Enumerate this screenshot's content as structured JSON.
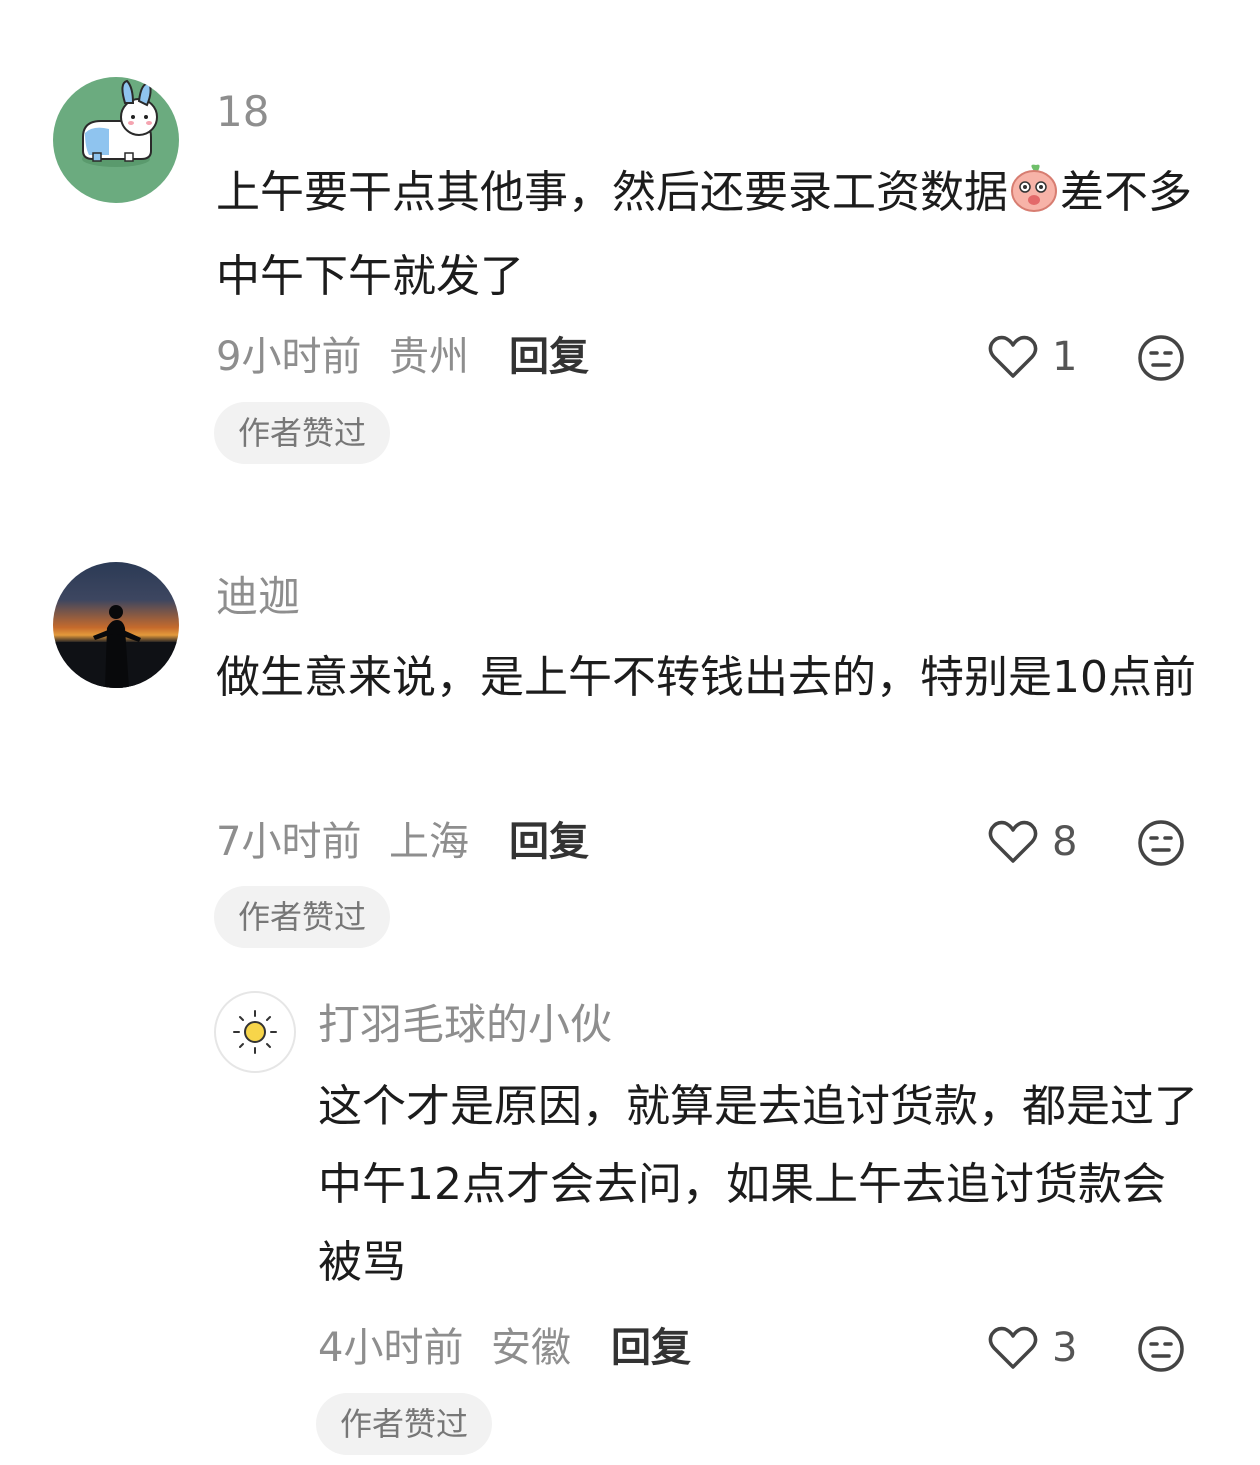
{
  "comments": [
    {
      "username": "18",
      "content_before_emoji": "上午要干点其他事，然后还要录工资数据",
      "content_after_emoji": "差不多中午下午就发了",
      "time": "9小时前",
      "location": "贵州",
      "reply_label": "回复",
      "likes": "1",
      "badge": "作者赞过",
      "avatar_icon": "bunny-avatar-icon",
      "emoji_icon": "peach-emoji-icon"
    },
    {
      "username": "迪迦",
      "content": "做生意来说，是上午不转钱出去的，特别是10点前",
      "time": "7小时前",
      "location": "上海",
      "reply_label": "回复",
      "likes": "8",
      "badge": "作者赞过",
      "avatar_icon": "sunset-silhouette-avatar-icon"
    },
    {
      "username": "打羽毛球的小伙",
      "content": "这个才是原因，就算是去追讨货款，都是过了中午12点才会去问，如果上午去追讨货款会被骂",
      "time": "4小时前",
      "location": "安徽",
      "reply_label": "回复",
      "likes": "3",
      "badge": "作者赞过",
      "avatar_icon": "sun-avatar-icon"
    }
  ],
  "colors": {
    "text_primary": "#1c1c1c",
    "text_secondary": "#8e8e8e",
    "badge_bg": "#f2f2f2"
  }
}
